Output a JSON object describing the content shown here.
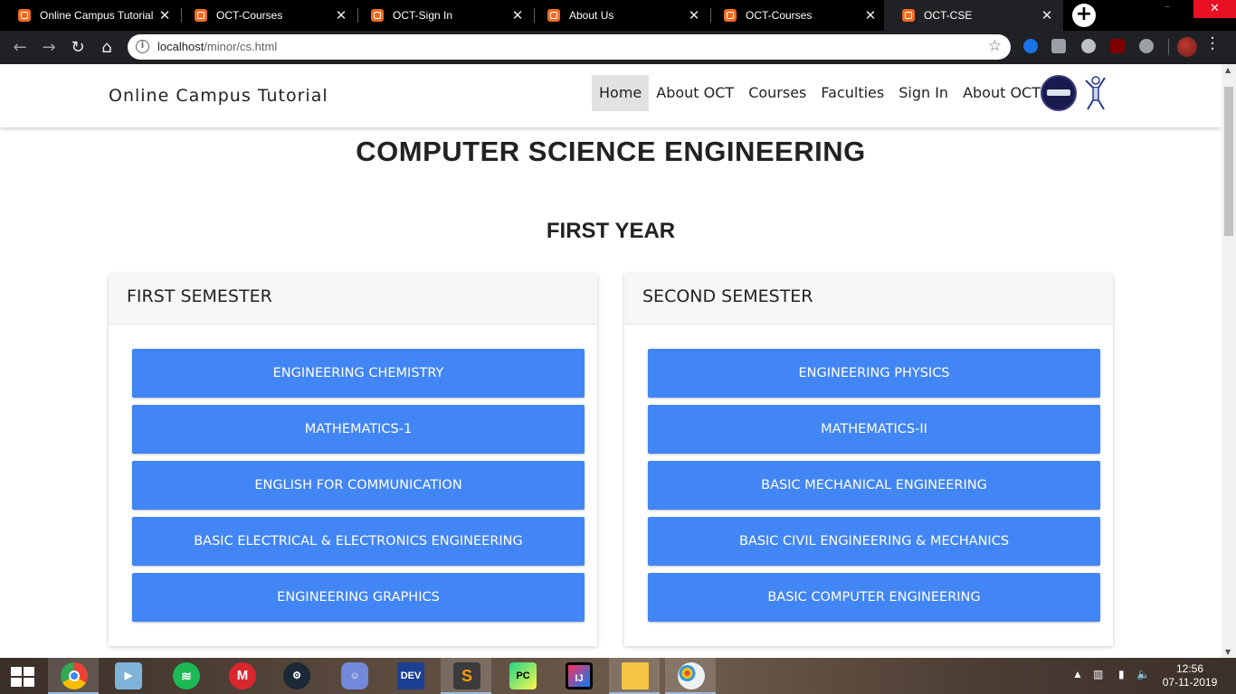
{
  "browser": {
    "tabs": [
      {
        "title": "Online Campus Tutorial",
        "active": false
      },
      {
        "title": "OCT-Courses",
        "active": false
      },
      {
        "title": "OCT-Sign In",
        "active": false
      },
      {
        "title": "About Us",
        "active": false
      },
      {
        "title": "OCT-Courses",
        "active": false
      },
      {
        "title": "OCT-CSE",
        "active": true
      }
    ],
    "url_host": "localhost",
    "url_path": "/minor/cs.html",
    "accent_color": "#4285f4"
  },
  "site": {
    "brand": "Online Campus Tutorial",
    "nav": [
      "Home",
      "About OCT",
      "Courses",
      "Faculties",
      "Sign In",
      "About OCT"
    ],
    "active_nav": "Home"
  },
  "page": {
    "title": "COMPUTER SCIENCE ENGINEERING",
    "year": "FIRST YEAR",
    "semesters": [
      {
        "name": "FIRST SEMESTER",
        "subjects": [
          "ENGINEERING CHEMISTRY",
          "MATHEMATICS-1",
          "ENGLISH FOR COMMUNICATION",
          "BASIC ELECTRICAL & ELECTRONICS ENGINEERING",
          "ENGINEERING GRAPHICS"
        ]
      },
      {
        "name": "SECOND SEMESTER",
        "subjects": [
          "ENGINEERING PHYSICS",
          "MATHEMATICS-II",
          "BASIC MECHANICAL ENGINEERING",
          "BASIC CIVIL ENGINEERING & MECHANICS",
          "BASIC COMPUTER ENGINEERING"
        ]
      }
    ]
  },
  "taskbar": {
    "apps": [
      {
        "name": "chrome-icon",
        "label": "",
        "open": true
      },
      {
        "name": "media-player-icon",
        "label": "",
        "open": false
      },
      {
        "name": "spotify-icon",
        "label": "",
        "open": false
      },
      {
        "name": "mega-icon",
        "label": "M",
        "open": false
      },
      {
        "name": "steam-icon",
        "label": "",
        "open": false
      },
      {
        "name": "discord-icon",
        "label": "",
        "open": false
      },
      {
        "name": "devcpp-icon",
        "label": "DEV",
        "open": false
      },
      {
        "name": "sublime-icon",
        "label": "S",
        "open": true
      },
      {
        "name": "pycharm-icon",
        "label": "PC",
        "open": false
      },
      {
        "name": "intellij-icon",
        "label": "IJ",
        "open": false
      },
      {
        "name": "file-explorer-icon",
        "label": "",
        "open": true
      },
      {
        "name": "paint-icon",
        "label": "",
        "open": true
      }
    ],
    "time": "12:56",
    "date": "07-11-2019"
  }
}
